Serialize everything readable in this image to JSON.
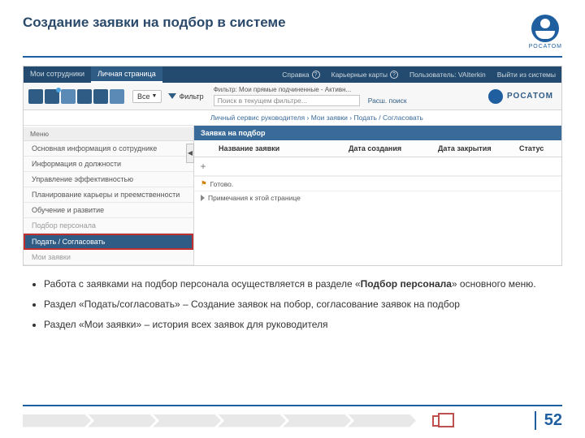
{
  "slide": {
    "title": "Создание заявки на подбор в системе",
    "logo_text": "РОСАТОМ",
    "page_number": "52"
  },
  "topnav": {
    "tab1": "Мои сотрудники",
    "tab2": "Личная страница",
    "help": "Справка",
    "career": "Карьерные карты",
    "user": "Пользователь: VAIterkin",
    "logout": "Выйти из системы"
  },
  "toolbar": {
    "all": "Все",
    "filter": "Фильтр",
    "filter_label": "Фильтр: Мои прямые подчиненные - Активн...",
    "search_placeholder": "Поиск в текущем фильтре...",
    "adv_search": "Расш. поиск",
    "brand": "РОСАТОМ"
  },
  "crumbs": "Личный сервис руководителя  ›  Мои заявки  ›  Подать / Согласовать",
  "sidebar": {
    "header": "Меню",
    "items": [
      "Основная информация о сотруднике",
      "Информация о должности",
      "Управление эффективностью",
      "Планирование карьеры и преемственности",
      "Обучение и развитие",
      "Подбор персонала",
      "Подать / Согласовать",
      "Мои заявки"
    ]
  },
  "content": {
    "section": "Заявка на подбор",
    "col_name": "Название заявки",
    "col_created": "Дата создания",
    "col_closed": "Дата закрытия",
    "col_status": "Статус",
    "plus": "+",
    "ready": "Готово.",
    "notes": "Примечания к этой странице"
  },
  "bullets": {
    "b1_pre": "Работа с заявками на подбор персонала осуществляется в разделе «",
    "b1_bold": "Подбор персонала",
    "b1_post": "» основного меню.",
    "b2": "Раздел «Подать/согласовать» – Создание заявок на побор, согласование заявок на подбор",
    "b3": "Раздел «Мои заявки» – история всех заявок для руководителя"
  }
}
